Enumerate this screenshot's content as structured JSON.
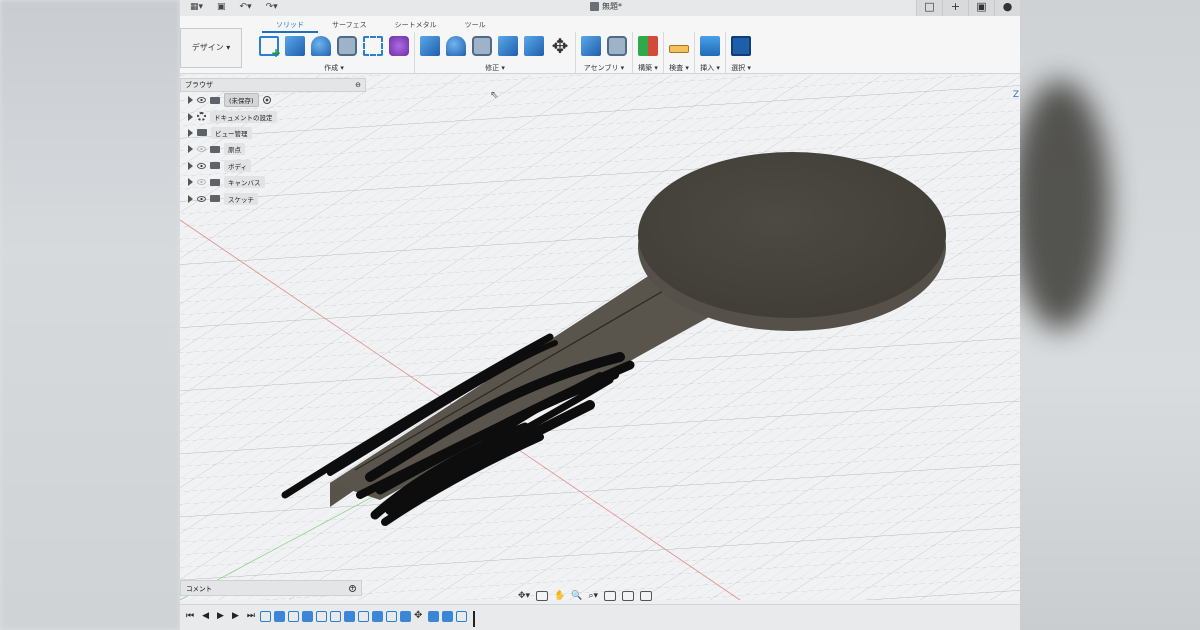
{
  "title_bar": {
    "doc_title": "無題*",
    "qat_labels": [
      "▦▾",
      "▣",
      "↶▾",
      "↷▾"
    ],
    "win_buttons": [
      "□",
      "+",
      "▣",
      "●"
    ]
  },
  "ribbon": {
    "workspace": "デザイン ▾",
    "tabs": [
      "ソリッド",
      "サーフェス",
      "シートメタル",
      "ツール"
    ],
    "active_tab_index": 0,
    "groups": [
      {
        "label": "作成 ▾"
      },
      {
        "label": "修正 ▾"
      },
      {
        "label": "アセンブリ ▾"
      },
      {
        "label": "構築 ▾"
      },
      {
        "label": "検査 ▾"
      },
      {
        "label": "挿入 ▾"
      },
      {
        "label": "選択 ▾"
      }
    ]
  },
  "browser": {
    "header": "ブラウザ",
    "root": "(未保存)",
    "items": [
      {
        "label": "ドキュメントの設定",
        "icon": "gear-icon"
      },
      {
        "label": "ビュー管理",
        "icon": "folder-icon"
      },
      {
        "label": "原点",
        "icon": "folder-icon",
        "eye_faded": true
      },
      {
        "label": "ボディ",
        "icon": "folder-icon"
      },
      {
        "label": "キャンバス",
        "icon": "folder-icon",
        "eye_faded": true
      },
      {
        "label": "スケッチ",
        "icon": "folder-icon"
      }
    ]
  },
  "comments": {
    "label": "コメント"
  },
  "view_cube": {
    "label": "Z"
  },
  "colors": {
    "accent": "#1e6fbf",
    "model_top": "#4a4640",
    "model_side": "#5c574f",
    "scribble": "#0d0d0d"
  }
}
